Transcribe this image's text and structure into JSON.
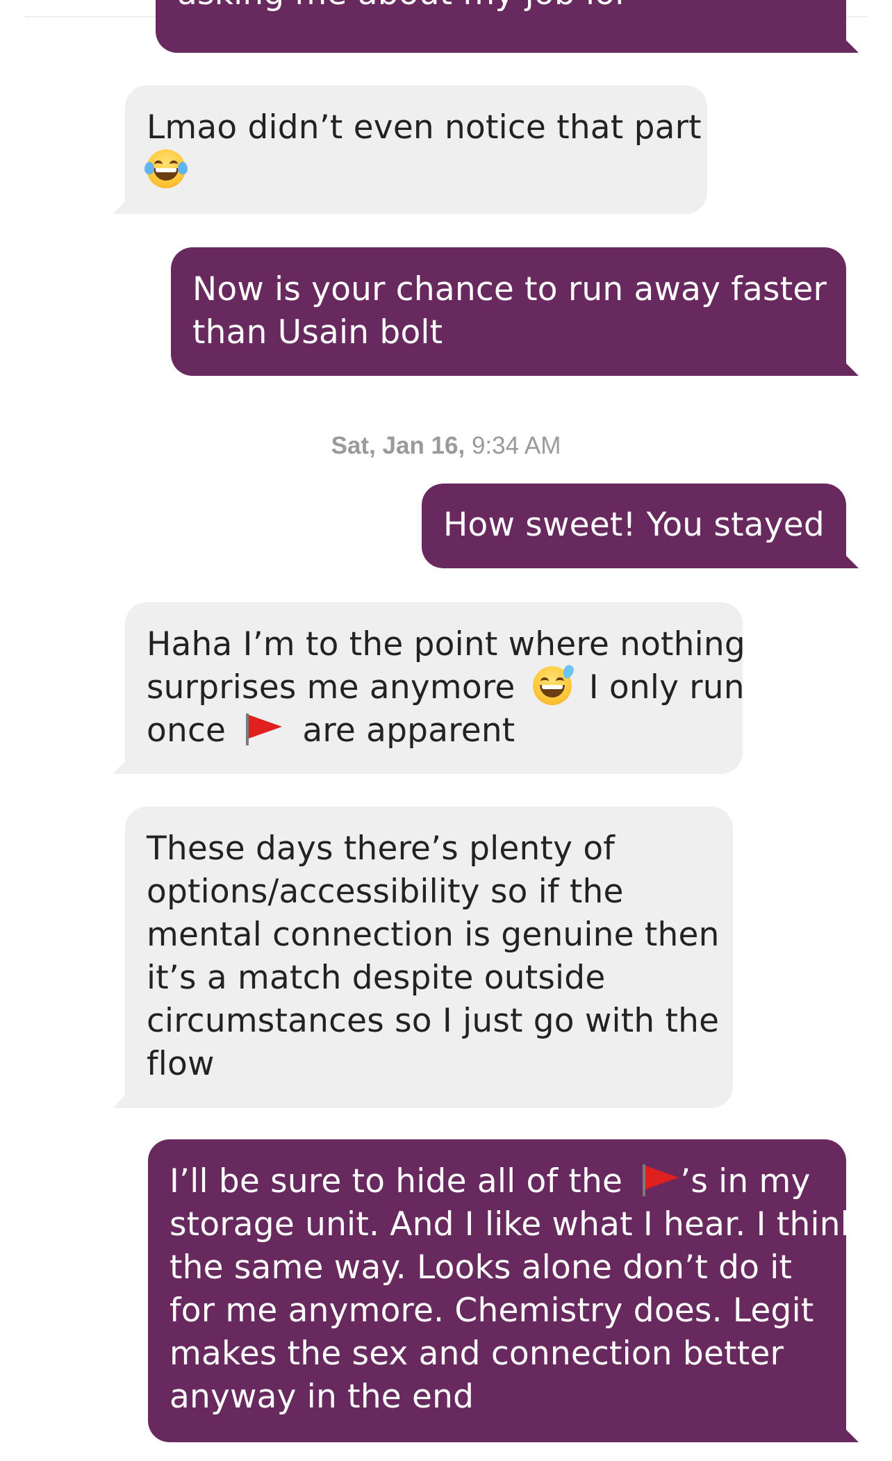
{
  "conversation": {
    "messages": [
      {
        "direction": "sent",
        "text_lines": [
          "asking me about my job lol"
        ]
      },
      {
        "direction": "received",
        "text_lines": [
          "Lmao didn’t even notice that part"
        ],
        "emoji": "face-with-tears-of-joy-icon"
      },
      {
        "direction": "sent",
        "text_lines": [
          "Now is your chance to run away faster",
          "than Usain bolt"
        ]
      },
      {
        "direction": "sent",
        "text_lines": [
          "How sweet! You stayed"
        ]
      },
      {
        "direction": "received",
        "text_lines": [
          "Haha I’m to the point where nothing",
          "surprises me anymore",
          "I only run",
          "once",
          "are apparent"
        ],
        "emojis": [
          "grinning-face-with-sweat-icon",
          "red-flag-icon"
        ]
      },
      {
        "direction": "received",
        "text_lines": [
          "These days there’s plenty of",
          "options/accessibility so if the",
          "mental connection is genuine then",
          "it’s a match despite outside",
          "circumstances so I just go with the",
          "flow"
        ]
      },
      {
        "direction": "sent",
        "text_lines": [
          "I’ll be sure to hide all of the",
          "’s in my",
          "storage unit. And I like what I hear. I think",
          "the same way. Looks alone don’t do it",
          "for me anymore. Chemistry does. Legit",
          "makes the sex and connection better",
          "anyway in the end"
        ],
        "emoji": "red-flag-icon"
      }
    ],
    "timestamp": {
      "date": "Sat, Jan 16,",
      "time": "9:34 AM"
    }
  },
  "colors": {
    "sent_bubble": "#682a5e",
    "received_bubble": "#efefef",
    "timestamp_text": "#9a9a9a"
  }
}
